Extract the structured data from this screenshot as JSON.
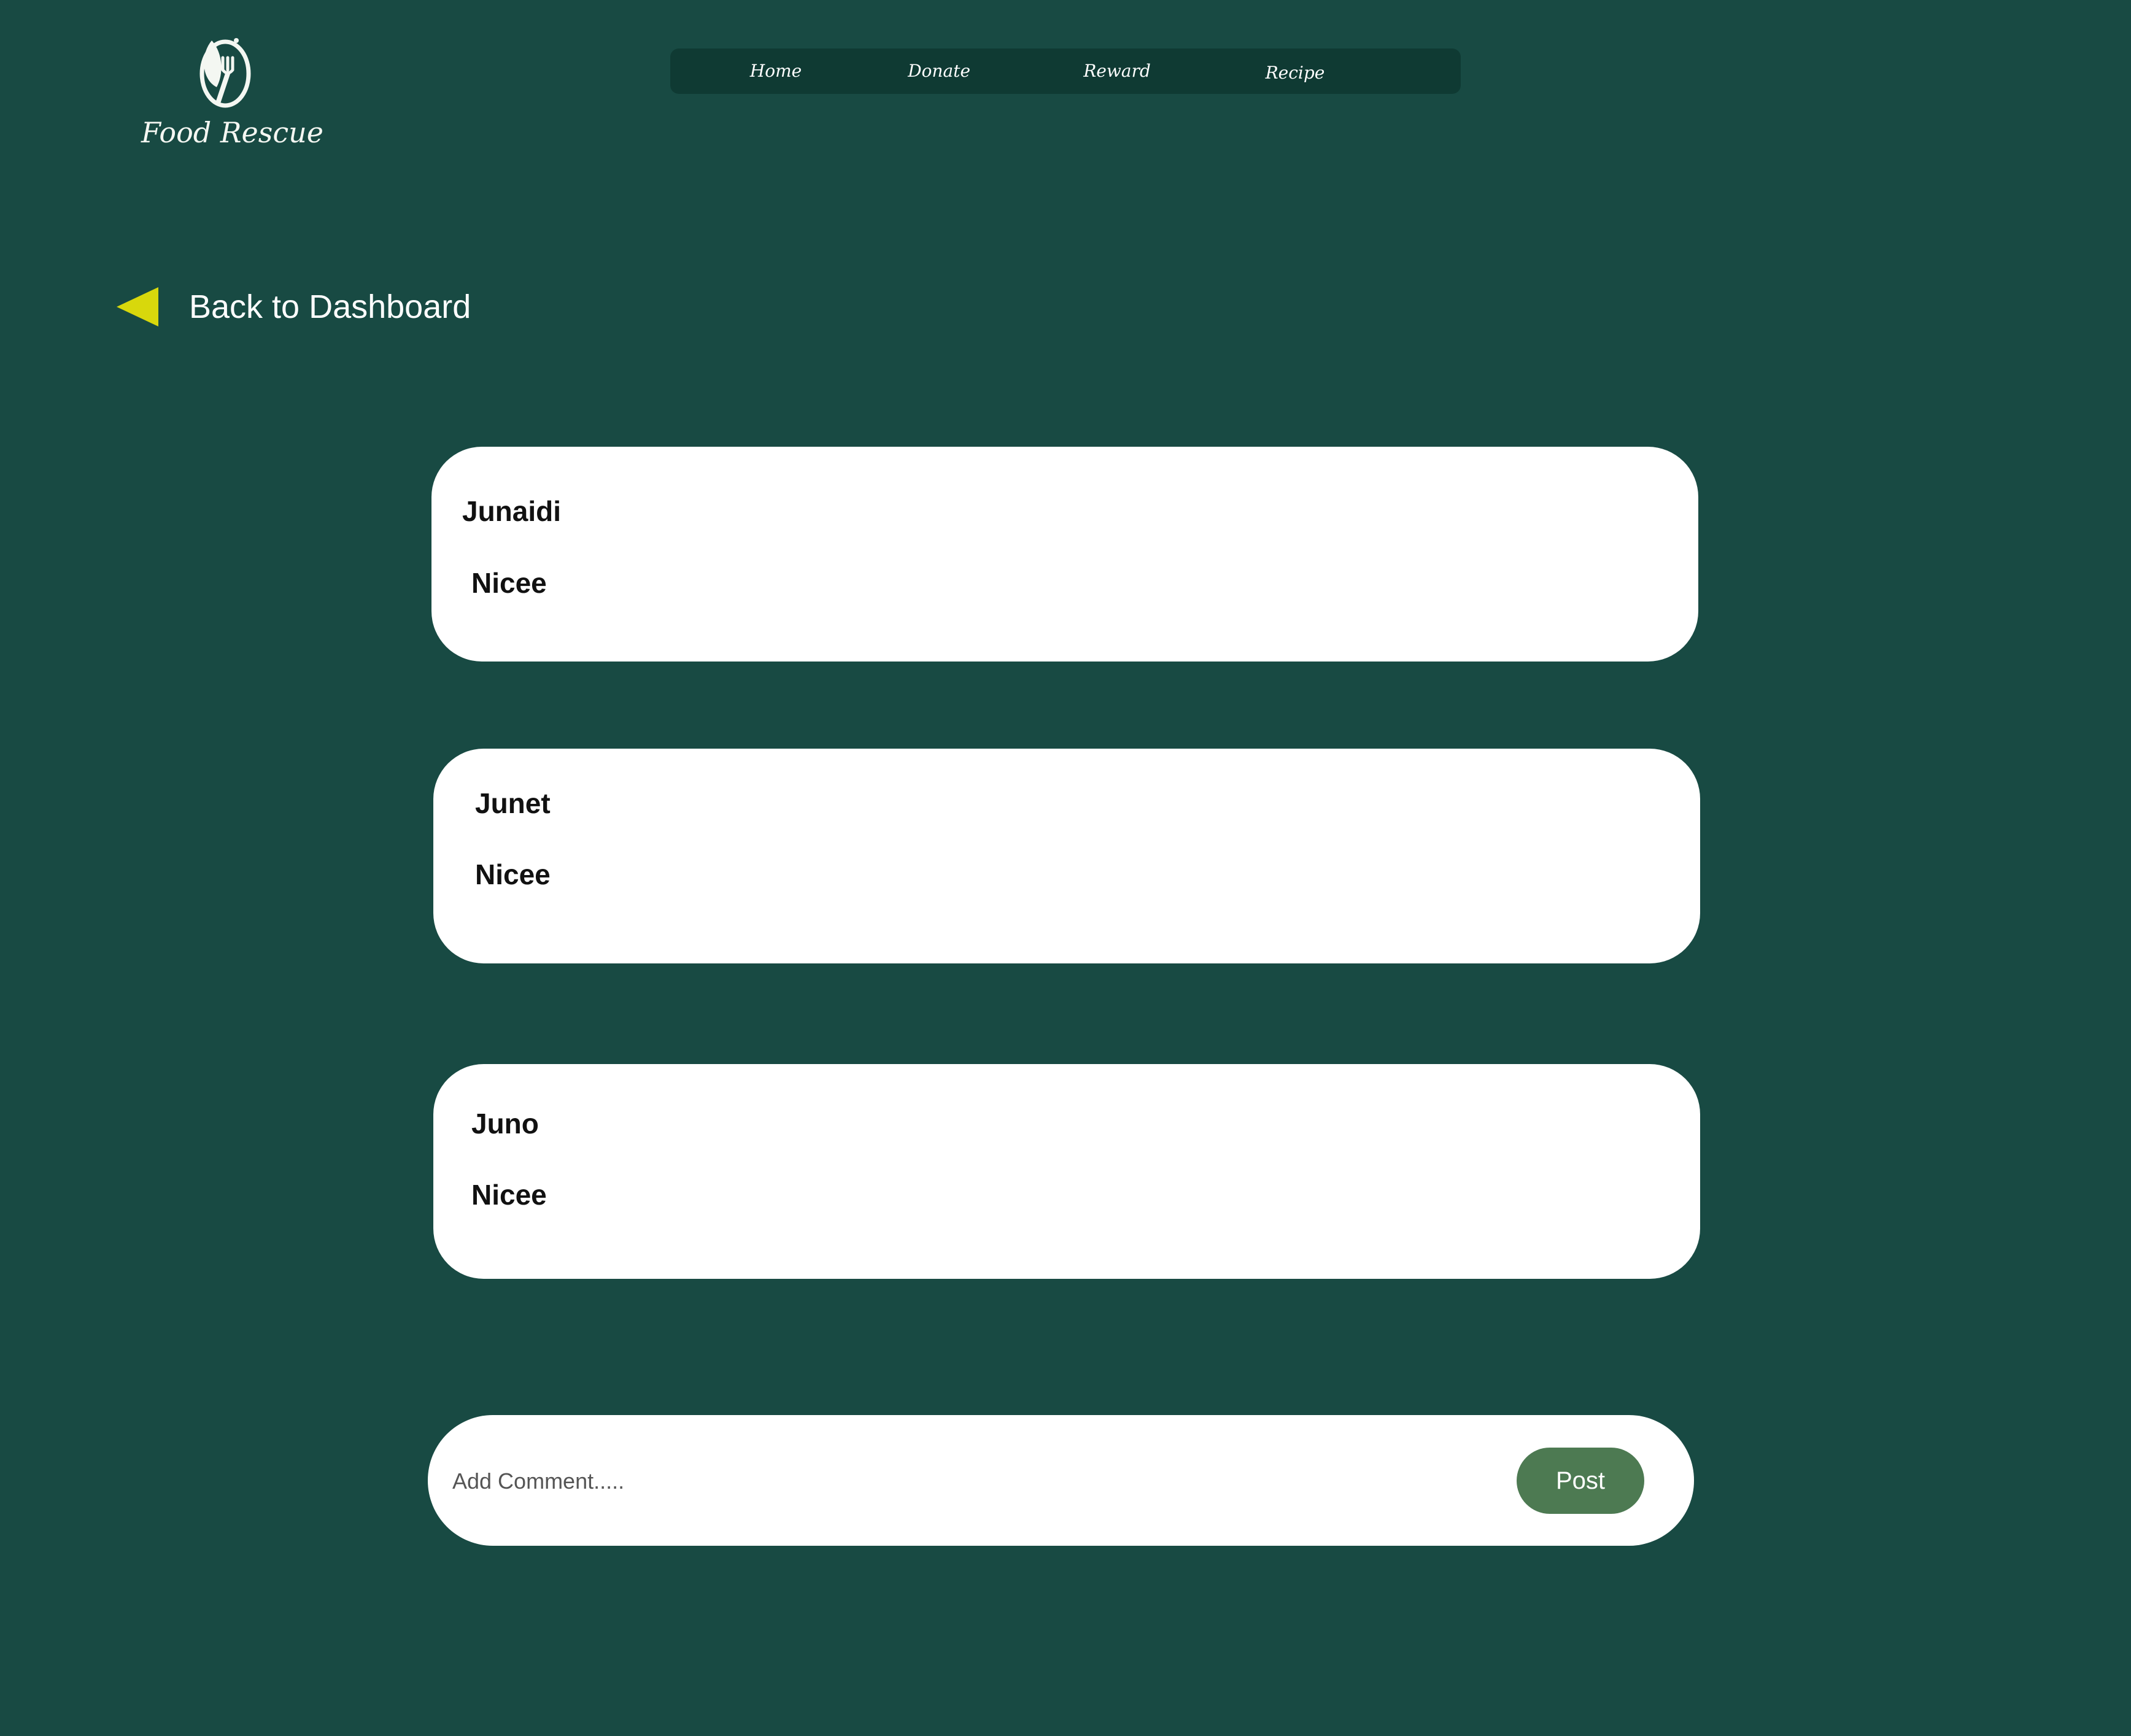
{
  "brand": {
    "name": "Food Rescue",
    "logo_icon": "leaf-fork-icon"
  },
  "nav": {
    "items": [
      {
        "label": "Home"
      },
      {
        "label": "Donate"
      },
      {
        "label": "Reward"
      },
      {
        "label": "Recipe"
      }
    ]
  },
  "back_link": {
    "label": "Back to Dashboard",
    "icon": "back-triangle-icon",
    "icon_color": "#d8d80c"
  },
  "comments": [
    {
      "author": "Junaidi",
      "text": "Nicee"
    },
    {
      "author": "Junet",
      "text": "Nicee"
    },
    {
      "author": "Juno",
      "text": "Nicee"
    }
  ],
  "composer": {
    "placeholder": "Add Comment.....",
    "value": "",
    "post_label": "Post"
  },
  "colors": {
    "background": "#184a43",
    "nav_background": "#0f3a33",
    "post_button": "#4d7a52"
  }
}
